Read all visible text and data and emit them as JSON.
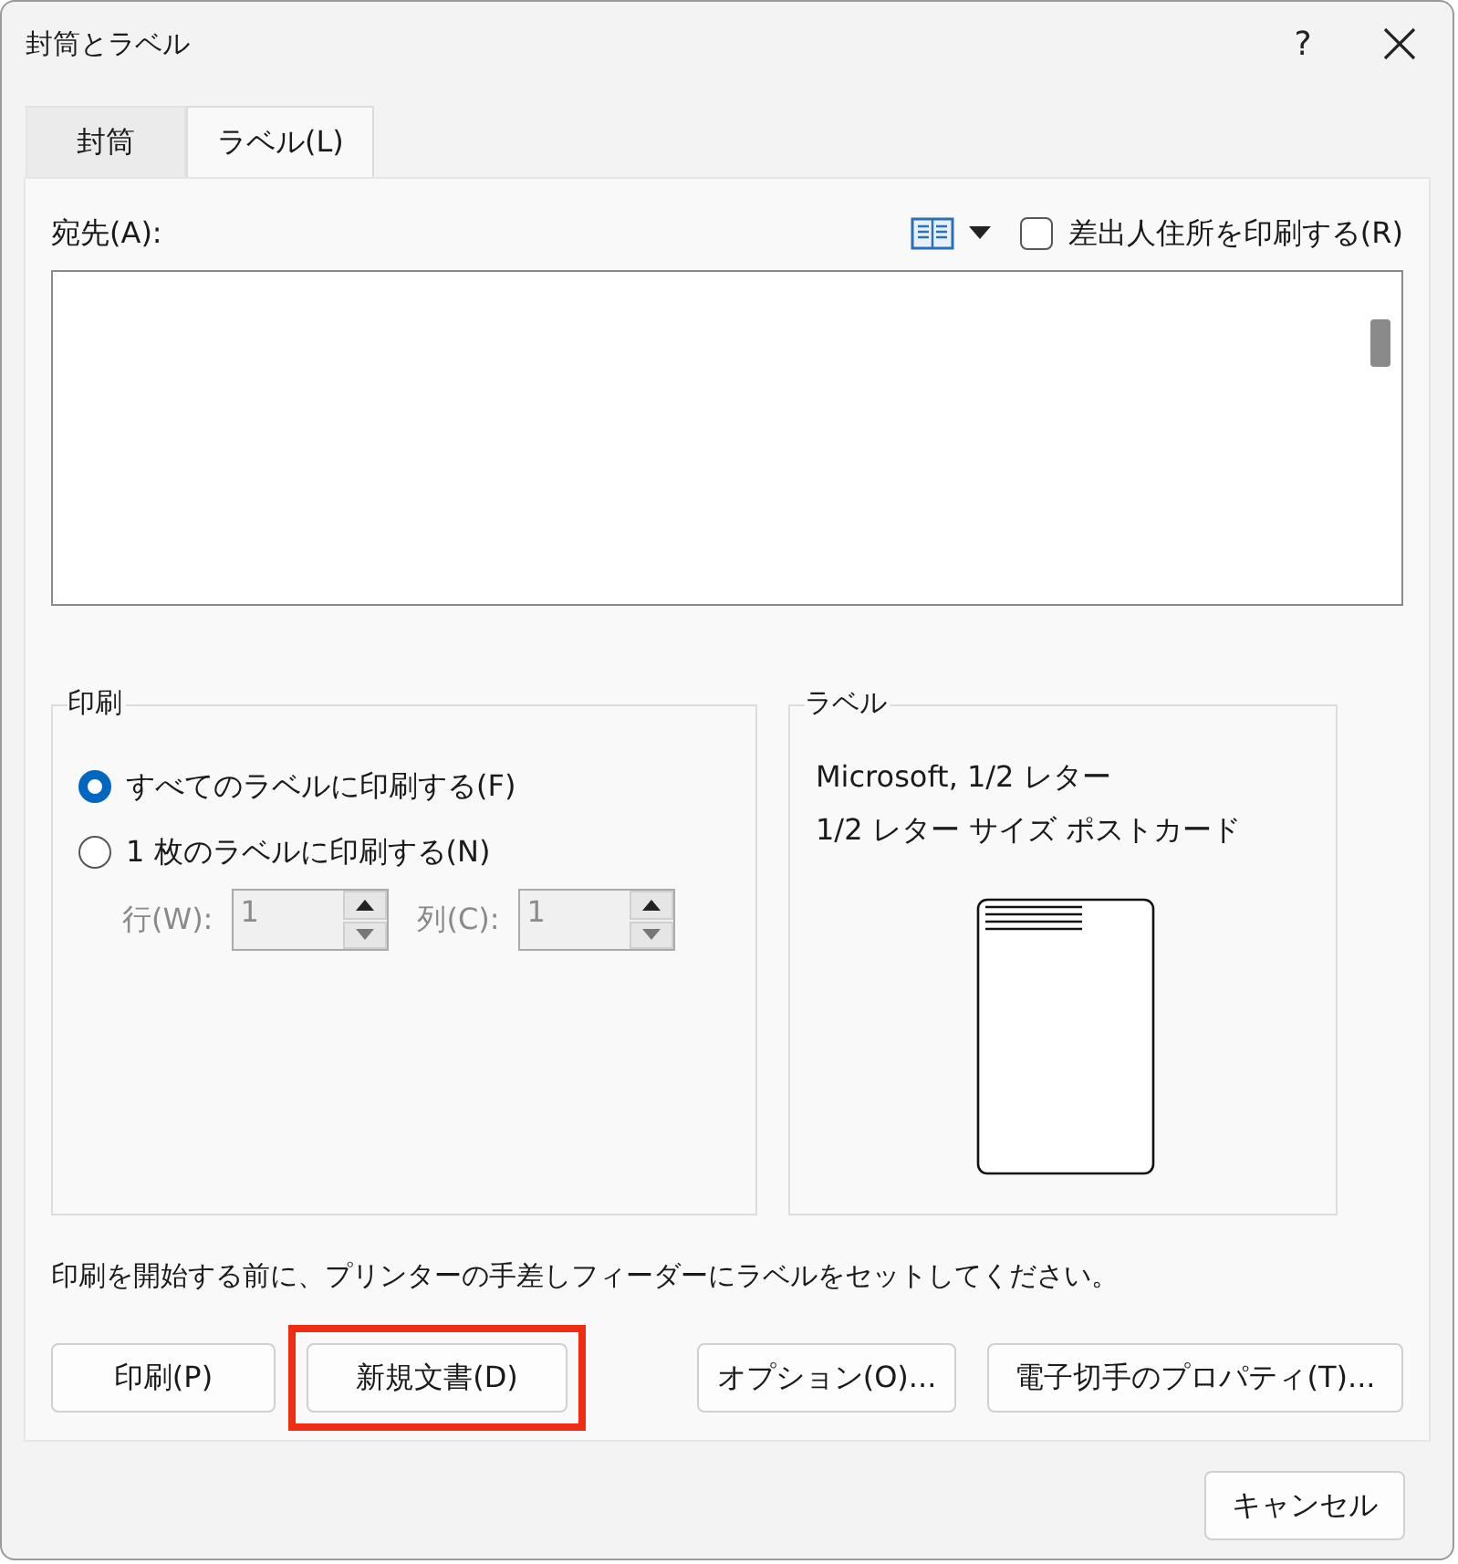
{
  "window": {
    "title": "封筒とラベル",
    "help": "?"
  },
  "tabs": [
    {
      "label": "封筒",
      "selected": false
    },
    {
      "label": "ラベル(L)",
      "selected": true
    }
  ],
  "address": {
    "label": "宛先(A):"
  },
  "return_address": {
    "label": "差出人住所を印刷する(R)",
    "checked": false
  },
  "print_group": {
    "title": "印刷",
    "options": [
      {
        "label": "すべてのラベルに印刷する(F)",
        "selected": true
      },
      {
        "label": "1 枚のラベルに印刷する(N)",
        "selected": false
      }
    ],
    "spinners": [
      {
        "label": "行(W):",
        "value": "1",
        "disabled": true
      },
      {
        "label": "列(C):",
        "value": "1",
        "disabled": true
      }
    ]
  },
  "label_group": {
    "title": "ラベル",
    "lines": [
      "Microsoft, 1/2 レター",
      "1/2 レター サイズ ポストカード"
    ]
  },
  "note": "印刷を開始する前に、プリンターの手差しフィーダーにラベルをセットしてください。",
  "buttons": [
    {
      "label": "印刷(P)",
      "highlighted": false
    },
    {
      "label": "新規文書(D)",
      "highlighted": true
    },
    {
      "label": "オプション(O)...",
      "highlighted": false
    },
    {
      "label": "電子切手のプロパティ(T)...",
      "highlighted": false
    }
  ],
  "cancel_button": "キャンセル"
}
